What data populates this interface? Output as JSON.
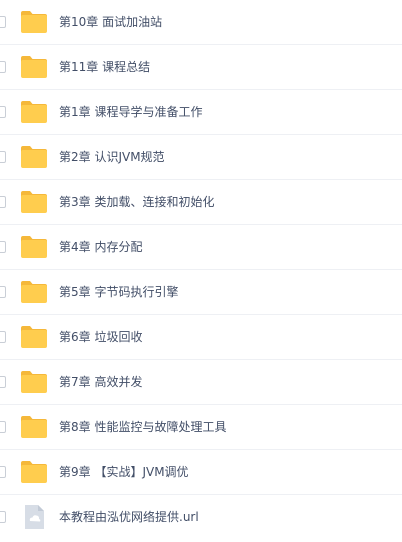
{
  "file_list": {
    "items": [
      {
        "name": "第10章 面试加油站",
        "icon": "folder-icon"
      },
      {
        "name": "第11章 课程总结",
        "icon": "folder-icon"
      },
      {
        "name": "第1章 课程导学与准备工作",
        "icon": "folder-icon"
      },
      {
        "name": "第2章 认识JVM规范",
        "icon": "folder-icon"
      },
      {
        "name": "第3章 类加载、连接和初始化",
        "icon": "folder-icon"
      },
      {
        "name": "第4章 内存分配",
        "icon": "folder-icon"
      },
      {
        "name": "第5章 字节码执行引擎",
        "icon": "folder-icon"
      },
      {
        "name": "第6章 垃圾回收",
        "icon": "folder-icon"
      },
      {
        "name": "第7章 高效并发",
        "icon": "folder-icon"
      },
      {
        "name": "第8章 性能监控与故障处理工具",
        "icon": "folder-icon"
      },
      {
        "name": "第9章 【实战】JVM调优",
        "icon": "folder-icon"
      },
      {
        "name": "本教程由泓优网络提供.url",
        "icon": "link-file-icon"
      }
    ]
  },
  "colors": {
    "folder": "#ffcd4e",
    "folder_tab": "#f5b83a",
    "text": "#424e67",
    "divider": "#eef0f4",
    "link_file": "#d7dde6"
  }
}
